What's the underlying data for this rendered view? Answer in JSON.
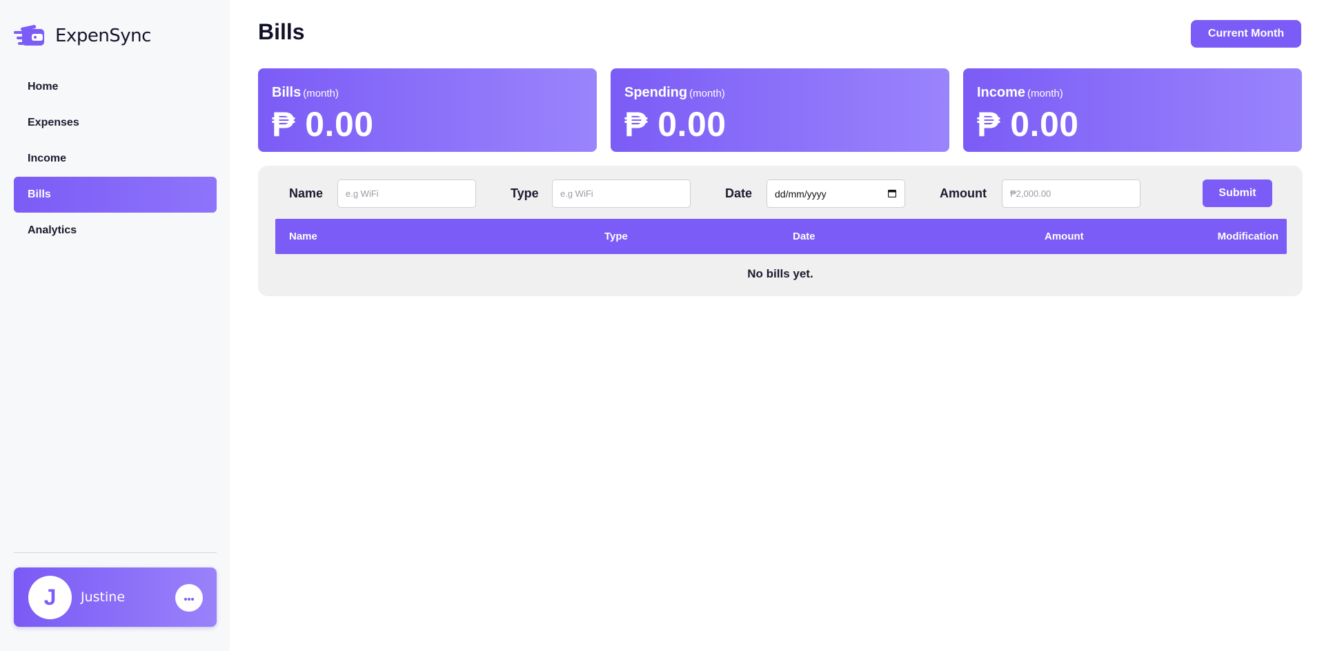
{
  "app": {
    "name": "ExpenSync"
  },
  "sidebar": {
    "items": [
      {
        "label": "Home",
        "active": false
      },
      {
        "label": "Expenses",
        "active": false
      },
      {
        "label": "Income",
        "active": false
      },
      {
        "label": "Bills",
        "active": true
      },
      {
        "label": "Analytics",
        "active": false
      }
    ],
    "user": {
      "initial": "J",
      "name": "Justine"
    }
  },
  "header": {
    "title": "Bills",
    "period_button": "Current Month"
  },
  "stats": [
    {
      "title": "Bills",
      "sub": "(month)",
      "value": "₱ 0.00"
    },
    {
      "title": "Spending",
      "sub": "(month)",
      "value": "₱ 0.00"
    },
    {
      "title": "Income",
      "sub": "(month)",
      "value": "₱ 0.00"
    }
  ],
  "form": {
    "name_label": "Name",
    "name_placeholder": "e.g WiFi",
    "type_label": "Type",
    "type_placeholder": "e.g WiFi",
    "date_label": "Date",
    "date_value": "dd/mm/yyyy",
    "amount_label": "Amount",
    "amount_placeholder": "₱2,000.00",
    "submit_label": "Submit"
  },
  "table": {
    "columns": [
      "Name",
      "Type",
      "Date",
      "Amount",
      "Modification"
    ],
    "empty_message": "No bills yet."
  },
  "colors": {
    "accent": "#7b5cf6",
    "sidebar_bg": "#f7f8fa",
    "panel_bg": "#f0f0f0"
  },
  "icons": {
    "logo": "wallet-logo-icon",
    "more": "more-dots-icon",
    "calendar": "calendar-icon"
  }
}
